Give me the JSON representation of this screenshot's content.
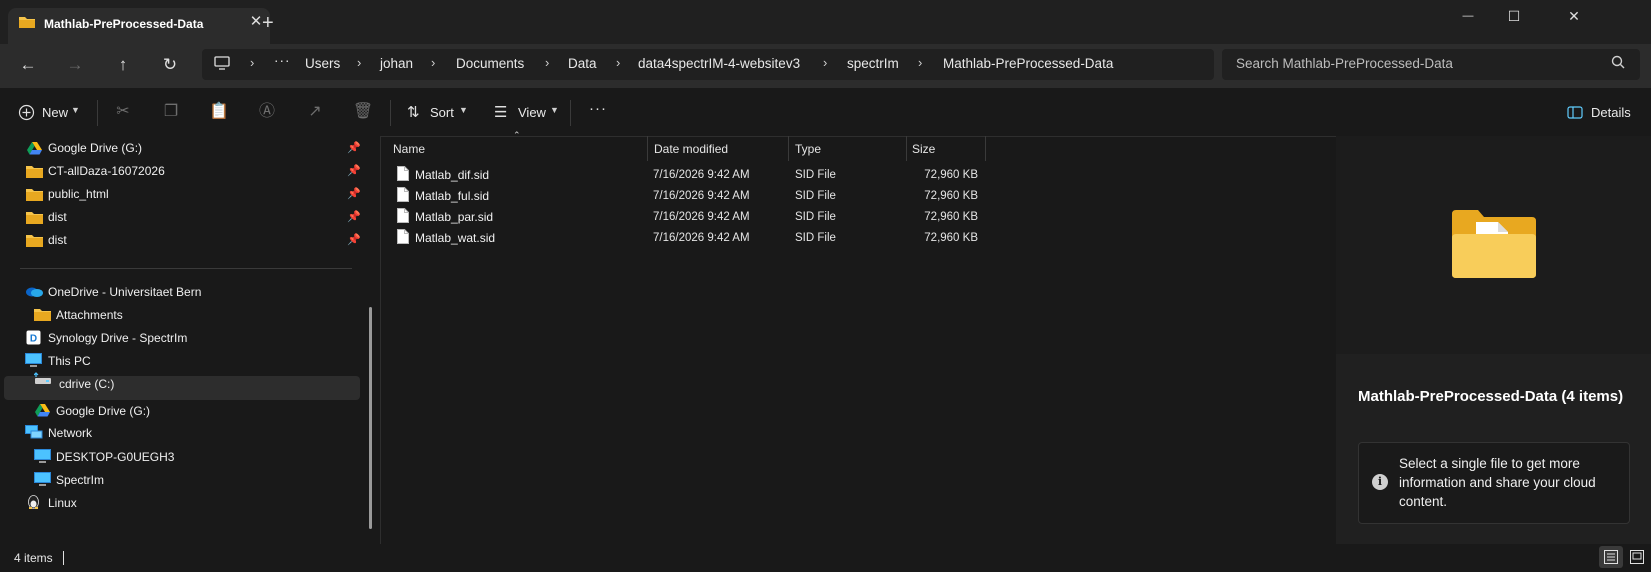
{
  "window": {
    "tab_title": "Mathlab-PreProcessed-Data",
    "tab_close": "✕",
    "new_tab": "+",
    "minimize": "—",
    "maximize": "☐",
    "close": "✕"
  },
  "nav": {
    "back": "←",
    "forward": "→",
    "up": "↑",
    "refresh": "↻",
    "overflow": "···",
    "breadcrumbs": [
      "Users",
      "johan",
      "Documents",
      "Data",
      "data4spectrIM-4-websitev3",
      "spectrIm",
      "Mathlab-PreProcessed-Data"
    ],
    "separator": "›"
  },
  "search": {
    "placeholder": "Search Mathlab-PreProcessed-Data"
  },
  "toolbar": {
    "new_label": "New",
    "sort_label": "Sort",
    "view_label": "View",
    "more_label": "···",
    "details_label": "Details"
  },
  "sidebar": {
    "items": [
      {
        "label": "Google Drive (G:)",
        "icon": "google-drive-icon",
        "pinned": true
      },
      {
        "label": "CT-allDaza-16072026",
        "icon": "folder-icon",
        "pinned": true
      },
      {
        "label": "public_html",
        "icon": "folder-icon",
        "pinned": true
      },
      {
        "label": "dist",
        "icon": "folder-icon",
        "pinned": true
      },
      {
        "label": "dist",
        "icon": "folder-icon",
        "pinned": true
      },
      {
        "label": "OneDrive - Universitaet Bern",
        "icon": "onedrive-icon",
        "pinned": false
      },
      {
        "label": "Attachments",
        "icon": "folder-icon",
        "pinned": false
      },
      {
        "label": "Synology Drive - SpectrIm",
        "icon": "synology-icon",
        "pinned": false
      },
      {
        "label": "This PC",
        "icon": "computer-icon",
        "pinned": false
      },
      {
        "label": "cdrive (C:)",
        "icon": "drive-icon",
        "pinned": false
      },
      {
        "label": "Google Drive (G:)",
        "icon": "google-drive-icon",
        "pinned": false
      },
      {
        "label": "Network",
        "icon": "network-icon",
        "pinned": false
      },
      {
        "label": "DESKTOP-G0UEGH3",
        "icon": "computer-icon",
        "pinned": false
      },
      {
        "label": "SpectrIm",
        "icon": "computer-icon",
        "pinned": false
      },
      {
        "label": "Linux",
        "icon": "linux-icon",
        "pinned": false
      }
    ]
  },
  "filelist": {
    "columns": [
      "Name",
      "Date modified",
      "Type",
      "Size"
    ],
    "rows": [
      {
        "name": "Matlab_dif.sid",
        "date": "7/16/2026 9:42 AM",
        "type": "SID File",
        "size": "72,960 KB"
      },
      {
        "name": "Matlab_ful.sid",
        "date": "7/16/2026 9:42 AM",
        "type": "SID File",
        "size": "72,960 KB"
      },
      {
        "name": "Matlab_par.sid",
        "date": "7/16/2026 9:42 AM",
        "type": "SID File",
        "size": "72,960 KB"
      },
      {
        "name": "Matlab_wat.sid",
        "date": "7/16/2026 9:42 AM",
        "type": "SID File",
        "size": "72,960 KB"
      }
    ]
  },
  "details": {
    "title": "Mathlab-PreProcessed-Data (4 items)",
    "info_text": "Select a single file to get more information and share your cloud content.",
    "info_icon": "i"
  },
  "status": {
    "item_count": "4 items"
  },
  "colors": {
    "folder": "#f6c44a",
    "background": "#191919",
    "accent": "#60cdff"
  }
}
